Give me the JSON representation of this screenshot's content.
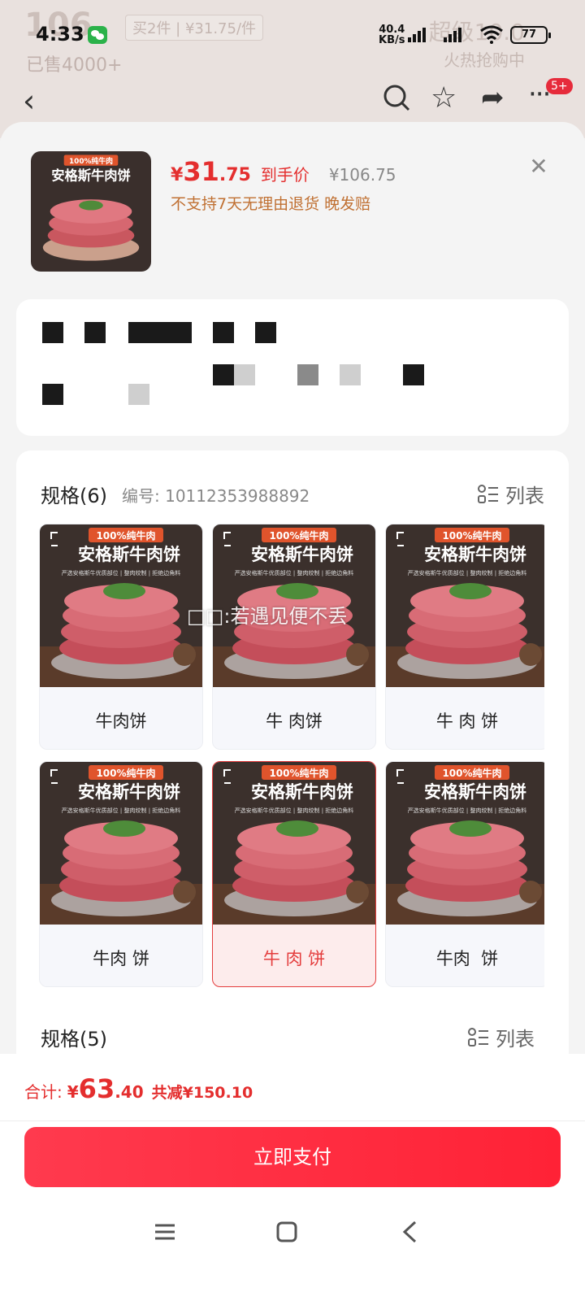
{
  "background": {
    "price_faded": "106",
    "promo_badge": "买2件 | ¥31.75/件",
    "sold": "已售4000+",
    "right_text": "超级10.0",
    "right_sub": "火热抢购中",
    "msg_badge": "5+"
  },
  "status_bar": {
    "time": "4:33",
    "net_speed_top": "40.4",
    "net_speed_bottom": "KB/s",
    "battery": "77"
  },
  "product": {
    "thumb_badge": "100%纯牛肉",
    "thumb_title": "安格斯牛肉饼",
    "price_currency": "¥",
    "price_int": "31",
    "price_dec": ".75",
    "price_label": "到手价",
    "price_original": "¥106.75",
    "policy": "不支持7天无理由退货  晚发赔"
  },
  "spec_section_1": {
    "title": "规格(6)",
    "code": "编号: 10112353988892",
    "list_label": "列表",
    "options": [
      {
        "label": "牛肉饼",
        "img_badge": "100%纯牛肉",
        "img_title": "安格斯牛肉饼",
        "img_sub": "严选安格斯牛优质部位 | 整肉绞制 | 拒绝边角料",
        "selected": false
      },
      {
        "label": "牛 肉饼",
        "img_badge": "100%纯牛肉",
        "img_title": "安格斯牛肉饼",
        "img_sub": "严选安格斯牛优质部位 | 整肉绞制 | 拒绝边角料",
        "selected": false
      },
      {
        "label": "牛 肉 饼",
        "img_badge": "100%纯牛肉",
        "img_title": "安格斯牛肉饼",
        "img_sub": "严选安格斯牛优质部位 | 整肉绞制 | 拒绝边角料",
        "selected": false
      },
      {
        "label": "牛肉 饼",
        "img_badge": "100%纯牛肉",
        "img_title": "安格斯牛肉饼",
        "img_sub": "严选安格斯牛优质部位 | 整肉绞制 | 拒绝边角料",
        "selected": false
      },
      {
        "label": "牛 肉 饼",
        "img_badge": "100%纯牛肉",
        "img_title": "安格斯牛肉饼",
        "img_sub": "严选安格斯牛优质部位 | 整肉绞制 | 拒绝边角料",
        "selected": true
      },
      {
        "label": "牛肉  饼",
        "img_badge": "100%纯牛肉",
        "img_title": "安格斯牛肉饼",
        "img_sub": "严选安格斯牛优质部位 | 整肉绞制 | 拒绝边角料",
        "selected": false
      }
    ],
    "watermark": "□□:若遇见便不丢"
  },
  "spec_section_2": {
    "title": "规格(5)",
    "list_label": "列表"
  },
  "footer": {
    "total_label": "合计:",
    "total_currency": "¥",
    "total_int": "63",
    "total_dec": ".40",
    "saving": "共减¥150.10",
    "pay_button": "立即支付"
  },
  "colors": {
    "accent": "#e42e2e",
    "pay_button": "#ff2236",
    "policy": "#c07032"
  }
}
